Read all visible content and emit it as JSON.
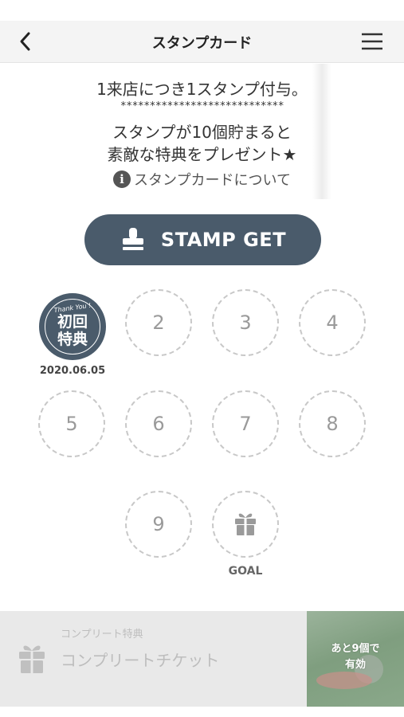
{
  "header": {
    "title": "スタンプカード",
    "back_icon": "chevron-left-icon",
    "menu_icon": "hamburger-menu-icon"
  },
  "info": {
    "line1": "1来店につき1スタンプ付与。",
    "divider": "****************************",
    "line2": "スタンプが10個貯まると",
    "line3": "素敵な特典をプレゼント★",
    "about_link": "スタンプカードについて",
    "about_icon": "info-icon"
  },
  "stamp_button": {
    "label": "STAMP GET",
    "icon": "stamp-icon"
  },
  "stamp_card": {
    "first_stamp": {
      "badge_top": "Thank You !",
      "badge_line1": "初回",
      "badge_line2": "特典",
      "date": "2020.06.05"
    },
    "slots": [
      "2",
      "3",
      "4",
      "5",
      "6",
      "7",
      "8",
      "9"
    ],
    "goal_icon": "gift-icon",
    "goal_label": "GOAL",
    "stamped_count": 1,
    "total": 10
  },
  "complete": {
    "sub_label": "コンプリート特典",
    "title": "コンプリートチケット",
    "icon": "gift-icon",
    "remaining_line1": "あと9個で",
    "remaining_line2": "有効"
  },
  "colors": {
    "accent": "#4a5b6b",
    "slot_border": "#c8c8c8",
    "complete_bg": "#e9e9e9"
  }
}
